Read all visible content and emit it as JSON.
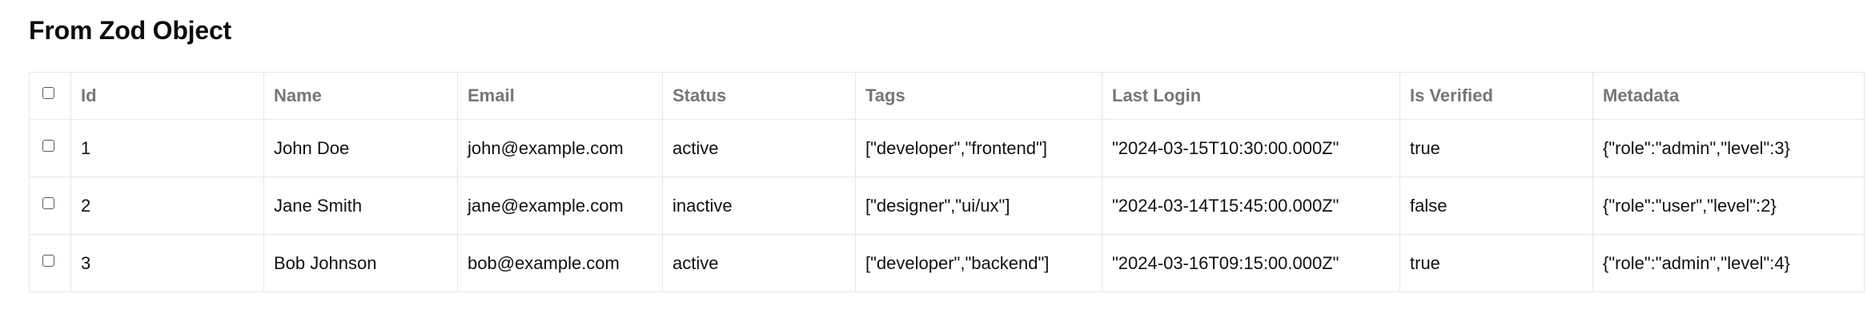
{
  "title": "From Zod Object",
  "table": {
    "columns": [
      "Id",
      "Name",
      "Email",
      "Status",
      "Tags",
      "Last Login",
      "Is Verified",
      "Metadata"
    ],
    "rows": [
      [
        "1",
        "John Doe",
        "john@example.com",
        "active",
        "[\"developer\",\"frontend\"]",
        "\"2024-03-15T10:30:00.000Z\"",
        "true",
        "{\"role\":\"admin\",\"level\":3}"
      ],
      [
        "2",
        "Jane Smith",
        "jane@example.com",
        "inactive",
        "[\"designer\",\"ui/ux\"]",
        "\"2024-03-14T15:45:00.000Z\"",
        "false",
        "{\"role\":\"user\",\"level\":2}"
      ],
      [
        "3",
        "Bob Johnson",
        "bob@example.com",
        "active",
        "[\"developer\",\"backend\"]",
        "\"2024-03-16T09:15:00.000Z\"",
        "true",
        "{\"role\":\"admin\",\"level\":4}"
      ]
    ]
  }
}
